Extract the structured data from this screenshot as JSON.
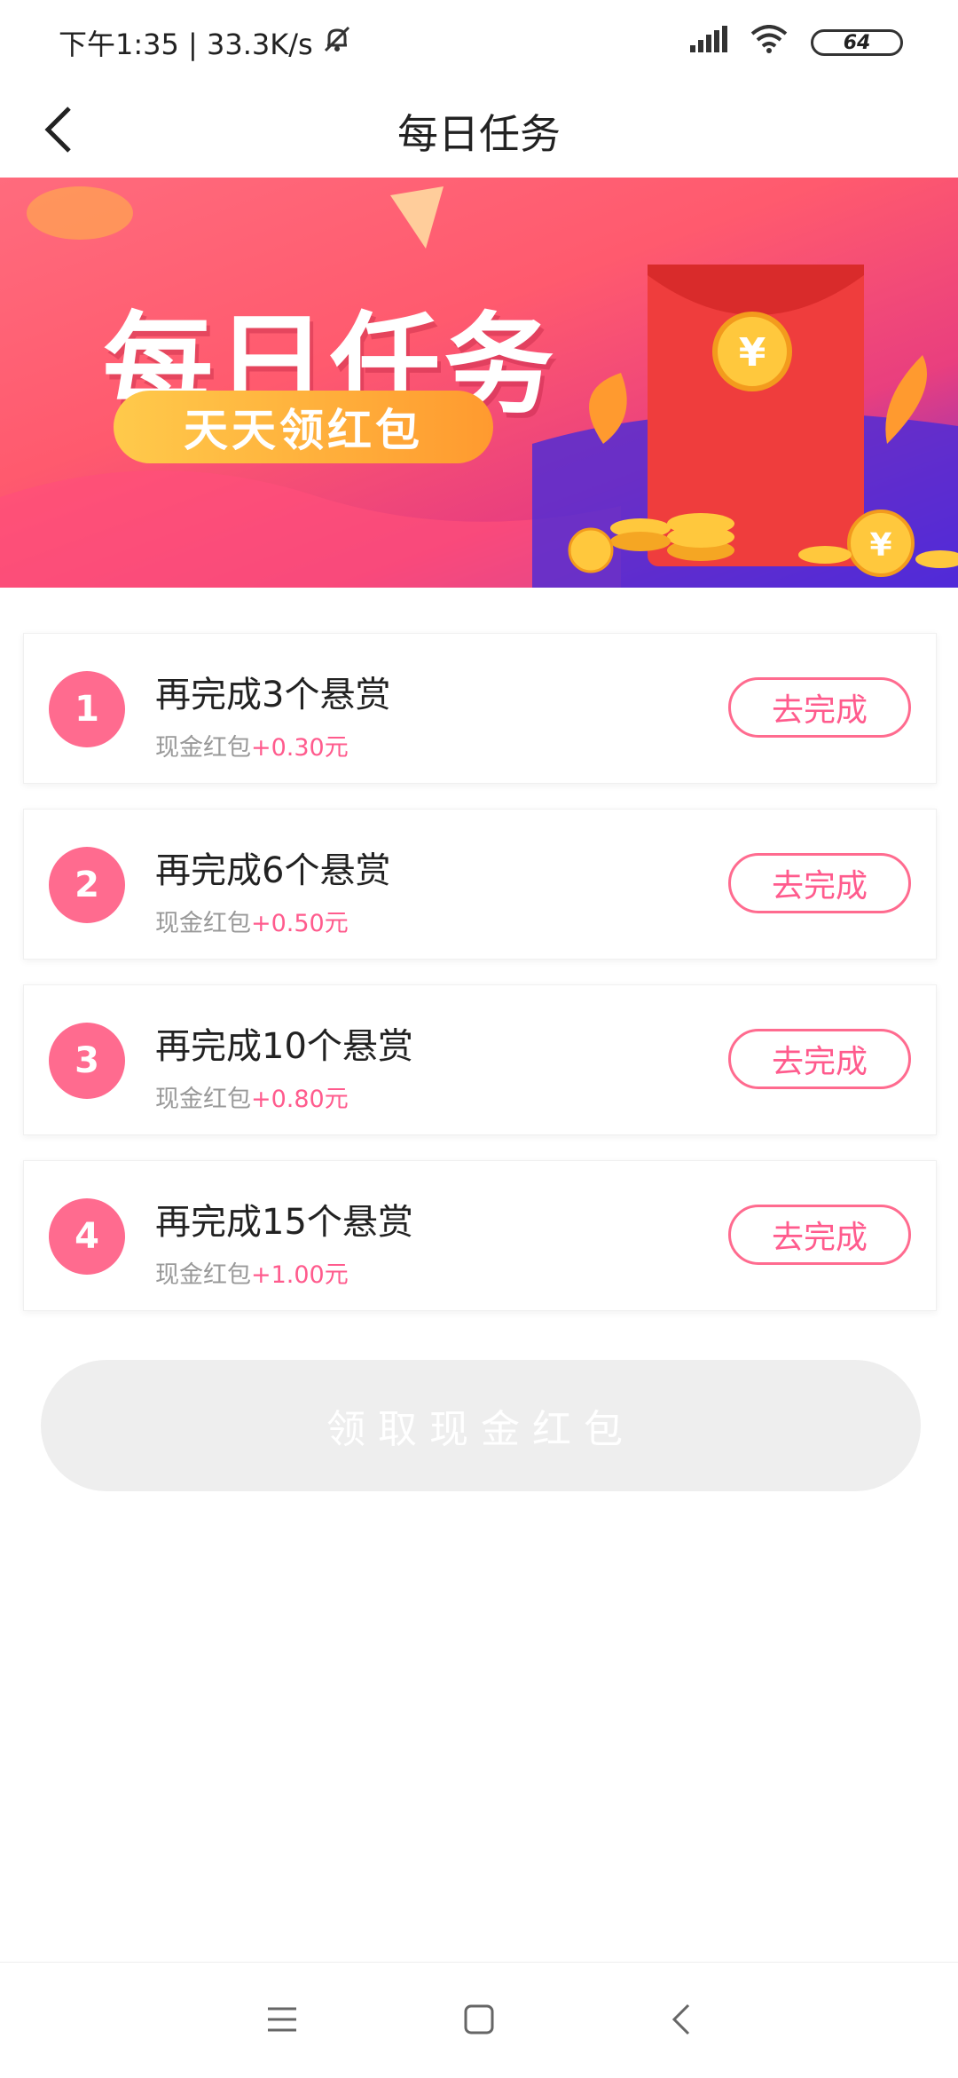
{
  "status_bar": {
    "time_net": "下午1:35 | 33.3K/s",
    "battery": "64"
  },
  "nav": {
    "title": "每日任务"
  },
  "banner": {
    "title": "每日任务",
    "subtitle": "天天领红包"
  },
  "tasks": [
    {
      "num": "1",
      "title": "再完成3个悬赏",
      "reward_prefix": "现金红包",
      "reward_amount": "+0.30",
      "reward_suffix": "元",
      "button": "去完成"
    },
    {
      "num": "2",
      "title": "再完成6个悬赏",
      "reward_prefix": "现金红包",
      "reward_amount": "+0.50",
      "reward_suffix": "元",
      "button": "去完成"
    },
    {
      "num": "3",
      "title": "再完成10个悬赏",
      "reward_prefix": "现金红包",
      "reward_amount": "+0.80",
      "reward_suffix": "元",
      "button": "去完成"
    },
    {
      "num": "4",
      "title": "再完成15个悬赏",
      "reward_prefix": "现金红包",
      "reward_amount": "+1.00",
      "reward_suffix": "元",
      "button": "去完成"
    }
  ],
  "claim_button": "领取现金红包",
  "colors": {
    "accent": "#ff6b8f",
    "reward": "#ff5b8d",
    "disabled_btn": "#eeeeee"
  }
}
